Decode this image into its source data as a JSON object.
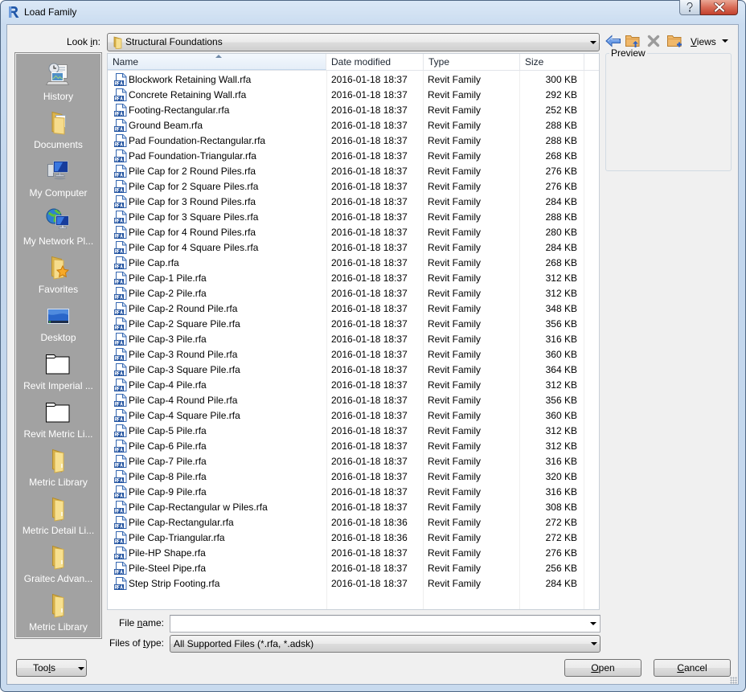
{
  "window": {
    "title": "Load Family",
    "app_icon": "revit-logo-icon",
    "help_icon": "help-icon",
    "close_icon": "close-icon"
  },
  "look_in": {
    "label": {
      "before": "Look ",
      "key": "i",
      "after": "n:"
    },
    "value": "Structural Foundations",
    "icon": "folder-icon"
  },
  "toolbar": {
    "back_icon": "back-icon",
    "up_icon": "up-one-level-icon",
    "delete_icon": "delete-icon",
    "new_folder_icon": "new-folder-icon",
    "views": {
      "before": "",
      "key": "V",
      "after": "iews"
    }
  },
  "preview": {
    "label": "Preview"
  },
  "sidebar": {
    "items": [
      {
        "label": "History",
        "icon": "history-icon"
      },
      {
        "label": "Documents",
        "icon": "documents-icon"
      },
      {
        "label": "My Computer",
        "icon": "my-computer-icon"
      },
      {
        "label": "My Network Pl...",
        "icon": "network-icon"
      },
      {
        "label": "Favorites",
        "icon": "favorites-icon"
      },
      {
        "label": "Desktop",
        "icon": "desktop-icon"
      },
      {
        "label": "Revit Imperial ...",
        "icon": "folder-outline-icon"
      },
      {
        "label": "Revit Metric Li...",
        "icon": "folder-outline-icon"
      },
      {
        "label": "Metric Library",
        "icon": "folder-icon"
      },
      {
        "label": "Metric Detail Li...",
        "icon": "folder-icon"
      },
      {
        "label": "Graitec Advan...",
        "icon": "folder-icon"
      },
      {
        "label": "Metric Library",
        "icon": "folder-icon"
      }
    ]
  },
  "file_list": {
    "columns": {
      "name": {
        "label": "Name",
        "sort": "ascending"
      },
      "date": {
        "label": "Date modified"
      },
      "type": {
        "label": "Type"
      },
      "size": {
        "label": "Size"
      }
    },
    "rows": [
      {
        "name": "Blockwork Retaining Wall.rfa",
        "date": "2016-01-18 18:37",
        "type": "Revit Family",
        "size": "300 KB"
      },
      {
        "name": "Concrete Retaining Wall.rfa",
        "date": "2016-01-18 18:37",
        "type": "Revit Family",
        "size": "292 KB"
      },
      {
        "name": "Footing-Rectangular.rfa",
        "date": "2016-01-18 18:37",
        "type": "Revit Family",
        "size": "252 KB"
      },
      {
        "name": "Ground Beam.rfa",
        "date": "2016-01-18 18:37",
        "type": "Revit Family",
        "size": "288 KB"
      },
      {
        "name": "Pad Foundation-Rectangular.rfa",
        "date": "2016-01-18 18:37",
        "type": "Revit Family",
        "size": "288 KB"
      },
      {
        "name": "Pad Foundation-Triangular.rfa",
        "date": "2016-01-18 18:37",
        "type": "Revit Family",
        "size": "268 KB"
      },
      {
        "name": "Pile Cap for 2 Round Piles.rfa",
        "date": "2016-01-18 18:37",
        "type": "Revit Family",
        "size": "276 KB"
      },
      {
        "name": "Pile Cap for 2 Square Piles.rfa",
        "date": "2016-01-18 18:37",
        "type": "Revit Family",
        "size": "276 KB"
      },
      {
        "name": "Pile Cap for 3 Round Piles.rfa",
        "date": "2016-01-18 18:37",
        "type": "Revit Family",
        "size": "284 KB"
      },
      {
        "name": "Pile Cap for 3 Square Piles.rfa",
        "date": "2016-01-18 18:37",
        "type": "Revit Family",
        "size": "288 KB"
      },
      {
        "name": "Pile Cap for 4 Round Piles.rfa",
        "date": "2016-01-18 18:37",
        "type": "Revit Family",
        "size": "280 KB"
      },
      {
        "name": "Pile Cap for 4 Square Piles.rfa",
        "date": "2016-01-18 18:37",
        "type": "Revit Family",
        "size": "284 KB"
      },
      {
        "name": "Pile Cap.rfa",
        "date": "2016-01-18 18:37",
        "type": "Revit Family",
        "size": "268 KB"
      },
      {
        "name": "Pile Cap-1 Pile.rfa",
        "date": "2016-01-18 18:37",
        "type": "Revit Family",
        "size": "312 KB"
      },
      {
        "name": "Pile Cap-2 Pile.rfa",
        "date": "2016-01-18 18:37",
        "type": "Revit Family",
        "size": "312 KB"
      },
      {
        "name": "Pile Cap-2 Round Pile.rfa",
        "date": "2016-01-18 18:37",
        "type": "Revit Family",
        "size": "348 KB"
      },
      {
        "name": "Pile Cap-2 Square Pile.rfa",
        "date": "2016-01-18 18:37",
        "type": "Revit Family",
        "size": "356 KB"
      },
      {
        "name": "Pile Cap-3 Pile.rfa",
        "date": "2016-01-18 18:37",
        "type": "Revit Family",
        "size": "316 KB"
      },
      {
        "name": "Pile Cap-3 Round Pile.rfa",
        "date": "2016-01-18 18:37",
        "type": "Revit Family",
        "size": "360 KB"
      },
      {
        "name": "Pile Cap-3 Square Pile.rfa",
        "date": "2016-01-18 18:37",
        "type": "Revit Family",
        "size": "364 KB"
      },
      {
        "name": "Pile Cap-4 Pile.rfa",
        "date": "2016-01-18 18:37",
        "type": "Revit Family",
        "size": "312 KB"
      },
      {
        "name": "Pile Cap-4 Round Pile.rfa",
        "date": "2016-01-18 18:37",
        "type": "Revit Family",
        "size": "356 KB"
      },
      {
        "name": "Pile Cap-4 Square Pile.rfa",
        "date": "2016-01-18 18:37",
        "type": "Revit Family",
        "size": "360 KB"
      },
      {
        "name": "Pile Cap-5 Pile.rfa",
        "date": "2016-01-18 18:37",
        "type": "Revit Family",
        "size": "312 KB"
      },
      {
        "name": "Pile Cap-6 Pile.rfa",
        "date": "2016-01-18 18:37",
        "type": "Revit Family",
        "size": "312 KB"
      },
      {
        "name": "Pile Cap-7 Pile.rfa",
        "date": "2016-01-18 18:37",
        "type": "Revit Family",
        "size": "316 KB"
      },
      {
        "name": "Pile Cap-8 Pile.rfa",
        "date": "2016-01-18 18:37",
        "type": "Revit Family",
        "size": "320 KB"
      },
      {
        "name": "Pile Cap-9 Pile.rfa",
        "date": "2016-01-18 18:37",
        "type": "Revit Family",
        "size": "316 KB"
      },
      {
        "name": "Pile Cap-Rectangular w Piles.rfa",
        "date": "2016-01-18 18:37",
        "type": "Revit Family",
        "size": "308 KB"
      },
      {
        "name": "Pile Cap-Rectangular.rfa",
        "date": "2016-01-18 18:36",
        "type": "Revit Family",
        "size": "272 KB"
      },
      {
        "name": "Pile Cap-Triangular.rfa",
        "date": "2016-01-18 18:36",
        "type": "Revit Family",
        "size": "272 KB"
      },
      {
        "name": "Pile-HP Shape.rfa",
        "date": "2016-01-18 18:37",
        "type": "Revit Family",
        "size": "276 KB"
      },
      {
        "name": "Pile-Steel Pipe.rfa",
        "date": "2016-01-18 18:37",
        "type": "Revit Family",
        "size": "256 KB"
      },
      {
        "name": "Step Strip Footing.rfa",
        "date": "2016-01-18 18:37",
        "type": "Revit Family",
        "size": "284 KB"
      }
    ],
    "file_icon": "rfa-file-icon"
  },
  "file_name": {
    "label": {
      "before": "File ",
      "key": "n",
      "after": "ame:"
    },
    "value": "",
    "placeholder": ""
  },
  "files_of_type": {
    "label": {
      "before": "Files of ",
      "key": "t",
      "after": "ype:"
    },
    "value": "All Supported Files  (*.rfa, *.adsk)"
  },
  "buttons": {
    "tools": {
      "before": "Too",
      "key": "l",
      "after": "s"
    },
    "open": {
      "before": "",
      "key": "O",
      "after": "pen"
    },
    "cancel": {
      "before": "",
      "key": "C",
      "after": "ancel"
    }
  }
}
